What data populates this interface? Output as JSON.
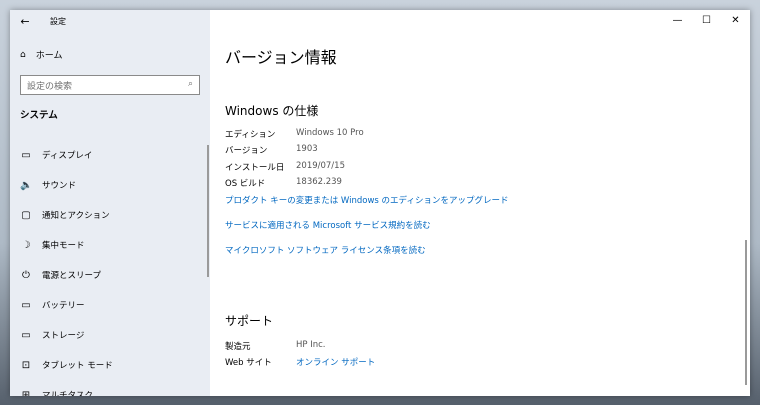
{
  "window": {
    "title": "設定",
    "back": "←",
    "minimize": "—",
    "maximize": "☐",
    "close": "✕"
  },
  "sidebar": {
    "home": "ホーム",
    "search_placeholder": "設定の検索",
    "section": "システム",
    "items": [
      {
        "icon": "display-icon",
        "glyph": "▭",
        "label": "ディスプレイ"
      },
      {
        "icon": "sound-icon",
        "glyph": "🔈",
        "label": "サウンド"
      },
      {
        "icon": "notification-icon",
        "glyph": "▢",
        "label": "通知とアクション"
      },
      {
        "icon": "focus-icon",
        "glyph": "☽",
        "label": "集中モード"
      },
      {
        "icon": "power-icon",
        "glyph": "⏻",
        "label": "電源とスリープ"
      },
      {
        "icon": "battery-icon",
        "glyph": "▭",
        "label": "バッテリー"
      },
      {
        "icon": "storage-icon",
        "glyph": "▭",
        "label": "ストレージ"
      },
      {
        "icon": "tablet-icon",
        "glyph": "⊡",
        "label": "タブレット モード"
      },
      {
        "icon": "multitask-icon",
        "glyph": "⊞",
        "label": "マルチタスク"
      }
    ]
  },
  "main": {
    "title": "バージョン情報",
    "spec_heading": "Windows の仕様",
    "specs": [
      {
        "k": "エディション",
        "v": "Windows 10 Pro"
      },
      {
        "k": "バージョン",
        "v": "1903"
      },
      {
        "k": "インストール日",
        "v": "2019/07/15"
      },
      {
        "k": "OS ビルド",
        "v": "18362.239"
      }
    ],
    "links": [
      "プロダクト キーの変更または Windows のエディションをアップグレード",
      "サービスに適用される Microsoft サービス規約を読む",
      "マイクロソフト ソフトウェア ライセンス条項を読む"
    ],
    "support_heading": "サポート",
    "support": {
      "maker_k": "製造元",
      "maker_v": "HP Inc.",
      "web_k": "Web サイト",
      "web_v": "オンライン サポート"
    }
  }
}
